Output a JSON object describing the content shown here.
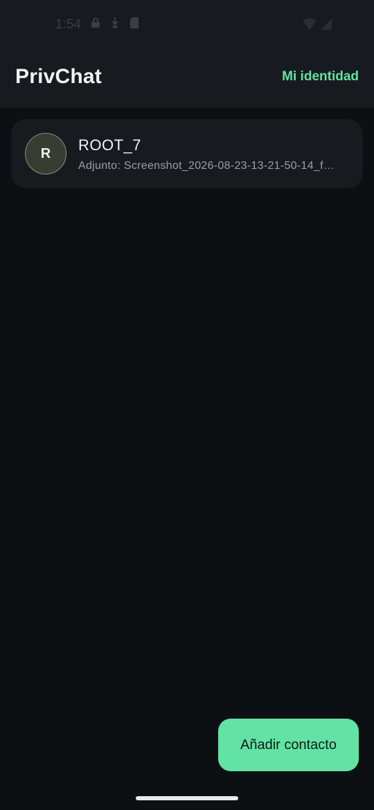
{
  "status_bar": {
    "time": "1:54",
    "icons": [
      "lock-icon",
      "download-icon",
      "sd-card-icon",
      "wifi-icon",
      "signal-icon"
    ]
  },
  "app_bar": {
    "title": "PrivChat",
    "identity_label": "Mi identidad"
  },
  "chats": [
    {
      "avatar_letter": "R",
      "name": "ROOT_7",
      "preview": "Adjunto: Screenshot_2026-08-23-13-21-50-14_f…"
    }
  ],
  "fab": {
    "label": "Añadir contacto"
  },
  "colors": {
    "accent": "#62e3a4",
    "background": "#0c1013",
    "surface": "#171b1f"
  }
}
